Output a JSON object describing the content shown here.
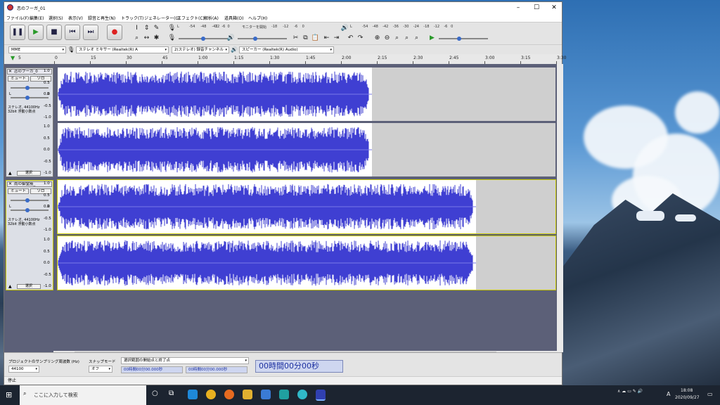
{
  "window": {
    "title": "恋のフーガ_01",
    "controls": {
      "minimize": "–",
      "maximize": "☐",
      "close": "✕"
    }
  },
  "menu": [
    "ファイル(F)",
    "編集(E)",
    "選択(S)",
    "表示(V)",
    "録音と再生(N)",
    "トラック(T)",
    "ジェネレーター(G)",
    "エフェクト(C)",
    "解析(A)",
    "道具箱(O)",
    "ヘルプ(H)"
  ],
  "transport": {
    "pause": "❚❚",
    "play": "▶",
    "stop": "■",
    "skip_start": "⏮",
    "skip_end": "⏭",
    "record": "●"
  },
  "meters": {
    "record_scale": [
      "L",
      "-54",
      "-48",
      "-42",
      "",
      "-18",
      "-12",
      "-6",
      "0"
    ],
    "monitor_label": "モニターを開始",
    "play_scale": [
      "L",
      "-54",
      "-48",
      "-42",
      "-36",
      "-30",
      "-24",
      "-18",
      "-12",
      "-6",
      "0"
    ],
    "left_scale": [
      "-12",
      "-6",
      "0"
    ]
  },
  "devices": {
    "host": "MME",
    "recording_device": "ステレオ ミキサー (Realtek(R) A",
    "channels": "2(ステレオ) 録音チャンネル",
    "playback_device": "スピーカー (Realtek(R) Audio)"
  },
  "ruler": {
    "start_marker": "5",
    "labels": [
      "0",
      "15",
      "30",
      "45",
      "1:00",
      "1:15",
      "1:30",
      "1:45",
      "2:00",
      "2:15",
      "2:30",
      "2:45",
      "3:00",
      "3:15",
      "3:30"
    ]
  },
  "tracks": [
    {
      "name": "恋のフーガ_0",
      "mute": "ミュート",
      "solo": "ソロ",
      "info_line1": "ステレオ, 44100Hz",
      "info_line2": "32bit 浮動小数点",
      "select": "選択",
      "scale": [
        "1.0",
        "0.5",
        "0.0",
        "-0.5",
        "-1.0"
      ],
      "duration_ratio": 0.632,
      "selected": false
    },
    {
      "name": "雨の御堂筋_",
      "mute": "ミュート",
      "solo": "ソロ",
      "info_line1": "ステレオ, 44100Hz",
      "info_line2": "32bit 浮動小数点",
      "select": "選択",
      "scale": [
        "1.0",
        "0.5",
        "0.0",
        "-0.5",
        "-1.0"
      ],
      "duration_ratio": 0.84,
      "selected": true
    }
  ],
  "bottom": {
    "rate_label": "プロジェクトのサンプリング周波数 (Hz)",
    "rate_value": "44100",
    "snap_label": "スナップモード",
    "snap_value": "オフ",
    "selection_label": "選択範囲の開始点と終了点",
    "sel_start": "00時間00分00.000秒",
    "sel_end": "00時間00分00.000秒",
    "audio_position": "00時間00分00秒"
  },
  "status": "停止",
  "taskbar": {
    "search_placeholder": "ここに入力して検索",
    "time": "18:08",
    "date": "2020/09/27",
    "ime": "A"
  },
  "colors": {
    "waveform": "#3f3fd2",
    "wave_bg": "#ffffff",
    "track_bg": "#cfcfcf",
    "selected_border": "#c8c800"
  }
}
